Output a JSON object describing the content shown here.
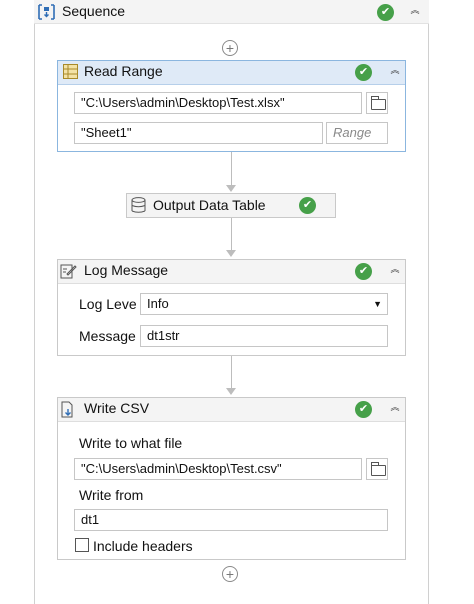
{
  "sequence": {
    "title": "Sequence"
  },
  "read_range": {
    "title": "Read Range",
    "workbook_path": "\"C:\\Users\\admin\\Desktop\\Test.xlsx\"",
    "sheet_name": "\"Sheet1\"",
    "range_placeholder": "Range"
  },
  "output_data_table": {
    "title": "Output Data Table"
  },
  "log_message": {
    "title": "Log Message",
    "level_label": "Log Leve",
    "level_value": "Info",
    "message_label": "Message",
    "message_value": "dt1str"
  },
  "write_csv": {
    "title": "Write CSV",
    "file_label": "Write to what file",
    "file_value": "\"C:\\Users\\admin\\Desktop\\Test.csv\"",
    "from_label": "Write from",
    "from_value": "dt1",
    "include_headers_label": "Include headers"
  },
  "icons": {
    "check": "✔",
    "plus": "+",
    "collapse": "︽",
    "dropdown": "▼"
  },
  "colors": {
    "success": "#46a049",
    "selected_border": "#8bb6df",
    "selected_header": "#dfeaf7"
  }
}
